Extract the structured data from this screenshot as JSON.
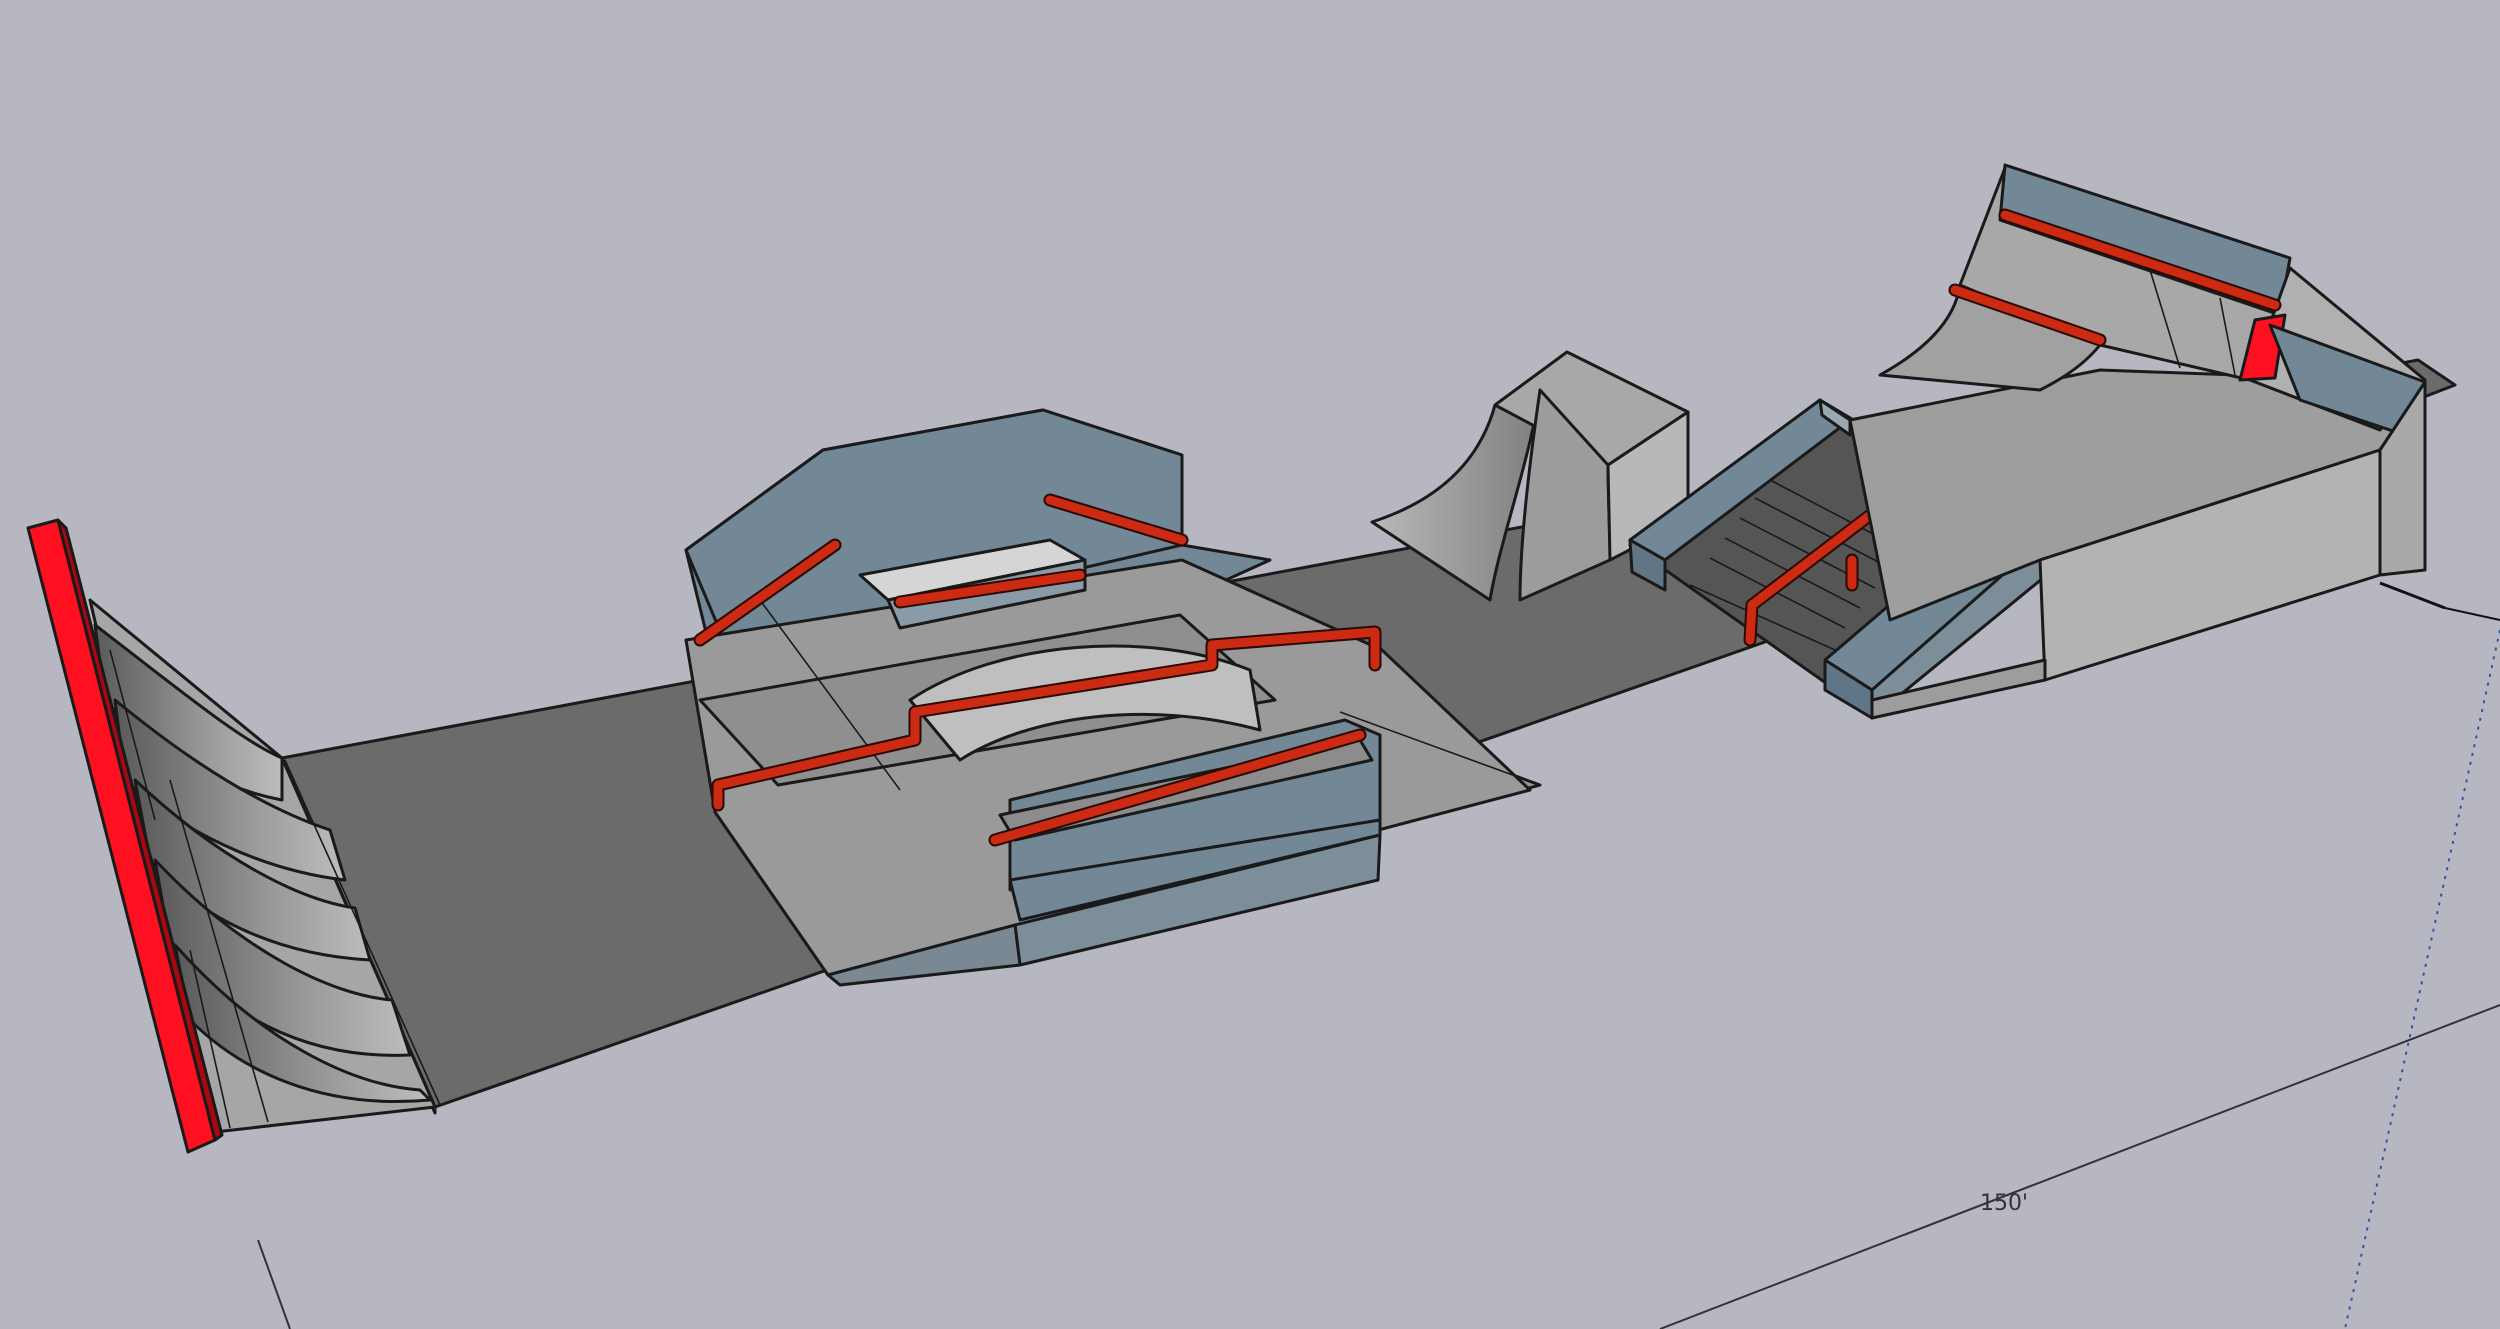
{
  "viewport": {
    "background": "#b6b7c0",
    "ground_color": "#6b6b6b",
    "ramp_face_color": "#9c9c9c",
    "wall_color": "#728897",
    "coping_color": "#ff1020"
  },
  "dimension": {
    "label": "150'"
  },
  "axes": {
    "green_axis_icon": "dotted-line",
    "red_axis_icon": "solid-line"
  }
}
